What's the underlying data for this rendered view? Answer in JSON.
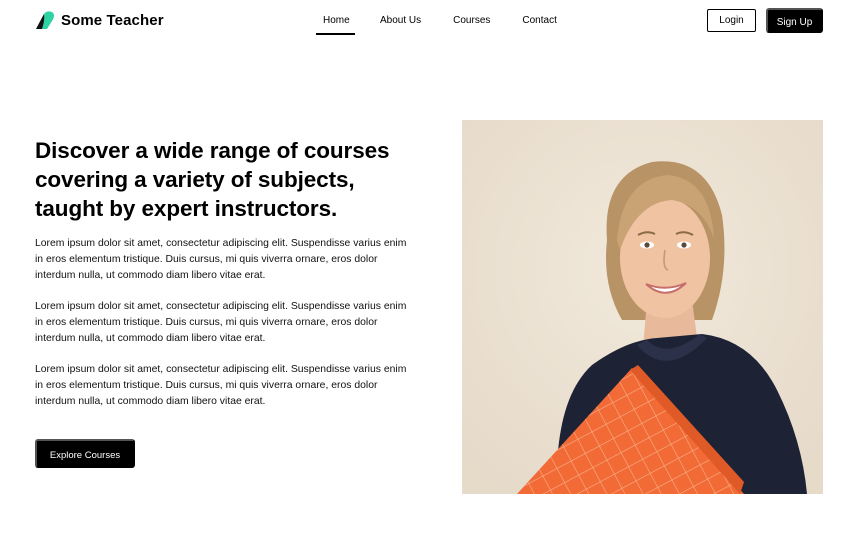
{
  "brand": {
    "name": "Some Teacher",
    "logo_icon": "leaf-logo-icon",
    "accent": "#2fd3a3"
  },
  "nav": {
    "items": [
      {
        "label": "Home",
        "active": true
      },
      {
        "label": "About Us",
        "active": false
      },
      {
        "label": "Courses",
        "active": false
      },
      {
        "label": "Contact",
        "active": false
      }
    ],
    "login_label": "Login",
    "signup_label": "Sign Up"
  },
  "hero": {
    "headline": "Discover a wide range of courses covering a variety of subjects, taught by expert instructors.",
    "paragraphs": [
      "Lorem ipsum dolor sit amet, consectetur adipiscing elit. Suspendisse varius enim in eros elementum tristique. Duis cursus, mi quis viverra ornare, eros dolor interdum nulla, ut commodo diam libero vitae erat.",
      "Lorem ipsum dolor sit amet, consectetur adipiscing elit. Suspendisse varius enim in eros elementum tristique. Duis cursus, mi quis viverra ornare, eros dolor interdum nulla, ut commodo diam libero vitae erat.",
      "Lorem ipsum dolor sit amet, consectetur adipiscing elit. Suspendisse varius enim in eros elementum tristique. Duis cursus, mi quis viverra ornare, eros dolor interdum nulla, ut commodo diam libero vitae erat."
    ],
    "cta_label": "Explore Courses"
  },
  "colors": {
    "primary": "#000000",
    "background": "#ffffff",
    "photo_background": "#ede3d5",
    "folder_orange": "#f26a35"
  }
}
